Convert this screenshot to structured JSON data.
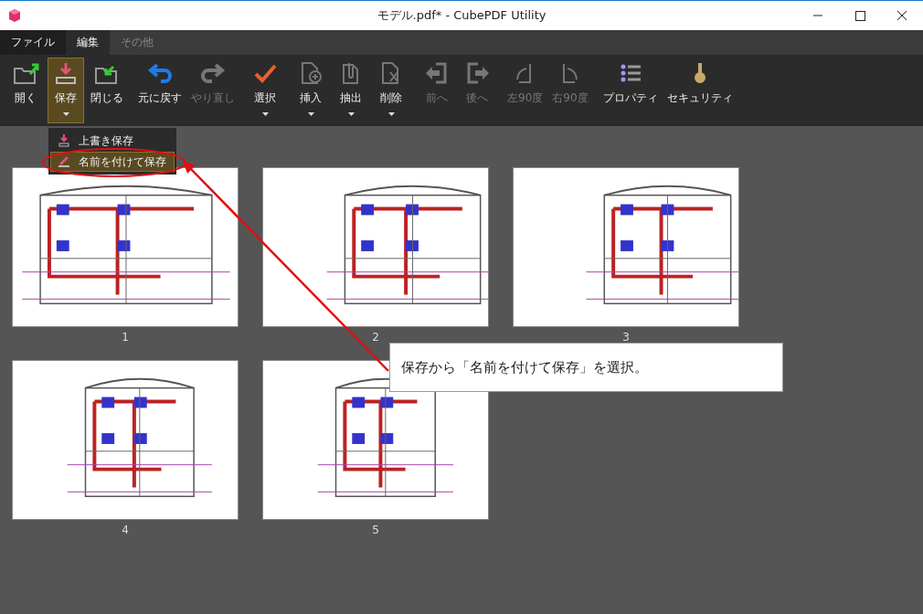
{
  "window": {
    "title": "モデル.pdf* - CubePDF Utility"
  },
  "menu_tabs": [
    {
      "label": "ファイル",
      "selected": false,
      "disabled": false,
      "kind": "file"
    },
    {
      "label": "編集",
      "selected": true,
      "disabled": false,
      "kind": "tab"
    },
    {
      "label": "その他",
      "selected": false,
      "disabled": true,
      "kind": "tab"
    }
  ],
  "toolbar": {
    "groups": [
      [
        {
          "label": "開く",
          "disabled": false,
          "selected": false,
          "has_menu": false
        },
        {
          "label": "保存",
          "disabled": false,
          "selected": true,
          "has_menu": true
        },
        {
          "label": "閉じる",
          "disabled": false,
          "selected": false,
          "has_menu": false
        }
      ],
      [
        {
          "label": "元に戻す",
          "disabled": false,
          "selected": false,
          "has_menu": false
        },
        {
          "label": "やり直し",
          "disabled": true,
          "selected": false,
          "has_menu": false
        }
      ],
      [
        {
          "label": "選択",
          "disabled": false,
          "selected": false,
          "has_menu": true
        }
      ],
      [
        {
          "label": "挿入",
          "disabled": false,
          "selected": false,
          "has_menu": true
        },
        {
          "label": "抽出",
          "disabled": false,
          "selected": false,
          "has_menu": true
        },
        {
          "label": "削除",
          "disabled": false,
          "selected": false,
          "has_menu": true
        }
      ],
      [
        {
          "label": "前へ",
          "disabled": true,
          "selected": false,
          "has_menu": false
        },
        {
          "label": "後へ",
          "disabled": true,
          "selected": false,
          "has_menu": false
        }
      ],
      [
        {
          "label": "左90度",
          "disabled": true,
          "selected": false,
          "has_menu": false
        },
        {
          "label": "右90度",
          "disabled": true,
          "selected": false,
          "has_menu": false
        }
      ],
      [
        {
          "label": "プロパティ",
          "disabled": false,
          "selected": false,
          "has_menu": false
        },
        {
          "label": "セキュリティ",
          "disabled": false,
          "selected": false,
          "has_menu": false
        }
      ]
    ]
  },
  "save_menu": [
    {
      "label": "上書き保存",
      "selected": false
    },
    {
      "label": "名前を付けて保存",
      "selected": true
    }
  ],
  "pages": [
    {
      "label": "1"
    },
    {
      "label": "2"
    },
    {
      "label": "3"
    },
    {
      "label": "4"
    },
    {
      "label": "5"
    }
  ],
  "annotation": {
    "text": "保存から「名前を付けて保存」を選択。"
  }
}
